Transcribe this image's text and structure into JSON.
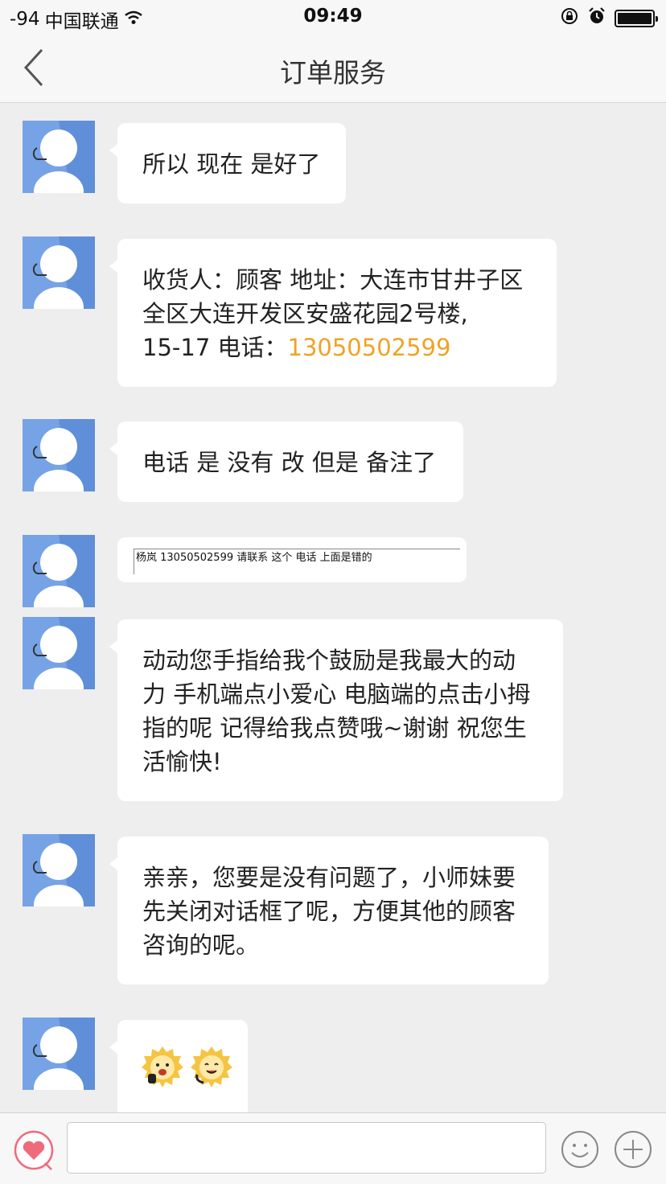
{
  "status_bar": {
    "signal": "-94",
    "carrier": "中国联通",
    "time": "09:49"
  },
  "nav": {
    "title": "订单服务",
    "back_icon": "chevron-left-icon"
  },
  "messages": [
    {
      "text": "所以 现在 是好了"
    },
    {
      "lines": [
        "收货人：顾客 地址：大连市甘井子区",
        "全区大连开发区安盛花园2号楼,"
      ],
      "last_prefix": "15-17 电话：",
      "phone": "13050502599"
    },
    {
      "text": "电话 是 没有 改 但是 备注了"
    },
    {
      "image_text": "杨岚 13050502599 请联系 这个 电话 上面是错的"
    },
    {
      "lines": [
        "动动您手指给我个鼓励是我最大的动",
        "力 手机端点小爱心 电脑端的点击小拇",
        "指的呢 记得给我点赞哦~谢谢  祝您生",
        "活愉快!"
      ]
    },
    {
      "lines": [
        "亲亲，您要是没有问题了，小师妹要",
        "先关闭对话框了呢，方便其他的顾客",
        "咨询的呢。"
      ]
    },
    {
      "stickers": [
        "sun-face-sticker",
        "sun-face-phone-sticker"
      ]
    }
  ],
  "input": {
    "value": "",
    "placeholder": ""
  },
  "icons": [
    "heart-icon",
    "emoji-icon",
    "plus-icon",
    "wifi-icon",
    "lock-rotation-icon",
    "alarm-icon",
    "battery-icon"
  ],
  "colors": {
    "avatar": "#76a3e6",
    "phone_link": "#f0a324",
    "heart": "#ef6b7b"
  }
}
